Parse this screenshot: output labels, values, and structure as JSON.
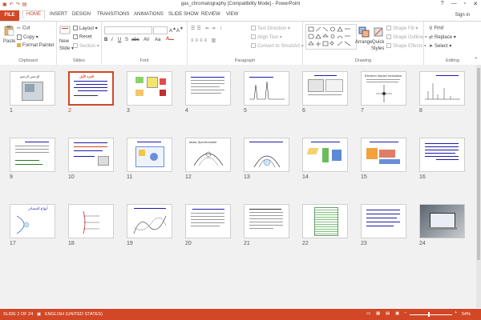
{
  "window": {
    "title": "gas_chromatography [Compatibility Mode] - PowerPoint",
    "controls": [
      "?",
      "—",
      "▫",
      "✕"
    ]
  },
  "qat": [
    "save-icon",
    "undo-icon",
    "redo-icon",
    "start-icon"
  ],
  "tabs": [
    "FILE",
    "HOME",
    "INSERT",
    "DESIGN",
    "TRANSITIONS",
    "ANIMATIONS",
    "SLIDE SHOW",
    "REVIEW",
    "VIEW"
  ],
  "active_tab": "HOME",
  "signin": "Sign in",
  "ribbon": {
    "clipboard": {
      "paste": "Paste",
      "cut": "Cut",
      "copy": "Copy",
      "format_painter": "Format Painter",
      "label": "Clipboard"
    },
    "slides": {
      "new_slide": "New",
      "new_slide2": "Slide",
      "layout": "Layout",
      "reset": "Reset",
      "section": "Section",
      "label": "Slides"
    },
    "font": {
      "label": "Font",
      "buttons": [
        "B",
        "I",
        "U",
        "S",
        "abc",
        "AV",
        "Aa"
      ]
    },
    "paragraph": {
      "text_direction": "Text Direction",
      "align_text": "Align Text",
      "convert": "Convert to SmartArt",
      "label": "Paragraph"
    },
    "drawing": {
      "arrange": "Arrange",
      "quick": "Quick",
      "styles": "Styles",
      "shape_fill": "Shape Fill",
      "shape_outline": "Shape Outline",
      "shape_effects": "Shape Effects",
      "label": "Drawing"
    },
    "editing": {
      "find": "Find",
      "replace": "Replace",
      "select": "Select",
      "label": "Editing"
    }
  },
  "slides": [
    {
      "n": "1",
      "title": "الرحمن الرحيم"
    },
    {
      "n": "2",
      "title": "الجزء الأول"
    },
    {
      "n": "3",
      "title": ""
    },
    {
      "n": "4",
      "title": ""
    },
    {
      "n": "5",
      "title": ""
    },
    {
      "n": "6",
      "title": ""
    },
    {
      "n": "7",
      "title": "Electron Impact Ionization"
    },
    {
      "n": "8",
      "title": ""
    },
    {
      "n": "9",
      "title": ""
    },
    {
      "n": "10",
      "title": ""
    },
    {
      "n": "11",
      "title": ""
    },
    {
      "n": "12",
      "title": "Mass Spectrometer"
    },
    {
      "n": "13",
      "title": ""
    },
    {
      "n": "14",
      "title": ""
    },
    {
      "n": "15",
      "title": ""
    },
    {
      "n": "16",
      "title": ""
    },
    {
      "n": "17",
      "title": "أنواع المصادر"
    },
    {
      "n": "18",
      "title": ""
    },
    {
      "n": "19",
      "title": ""
    },
    {
      "n": "20",
      "title": ""
    },
    {
      "n": "21",
      "title": ""
    },
    {
      "n": "22",
      "title": ""
    },
    {
      "n": "23",
      "title": ""
    },
    {
      "n": "24",
      "title": ""
    }
  ],
  "selected_slide": "2",
  "status": {
    "slide_of": "SLIDE 2 OF 24",
    "language": "ENGLISH (UNITED STATES)",
    "zoom": "54%"
  },
  "colors": {
    "accent": "#d24726"
  }
}
